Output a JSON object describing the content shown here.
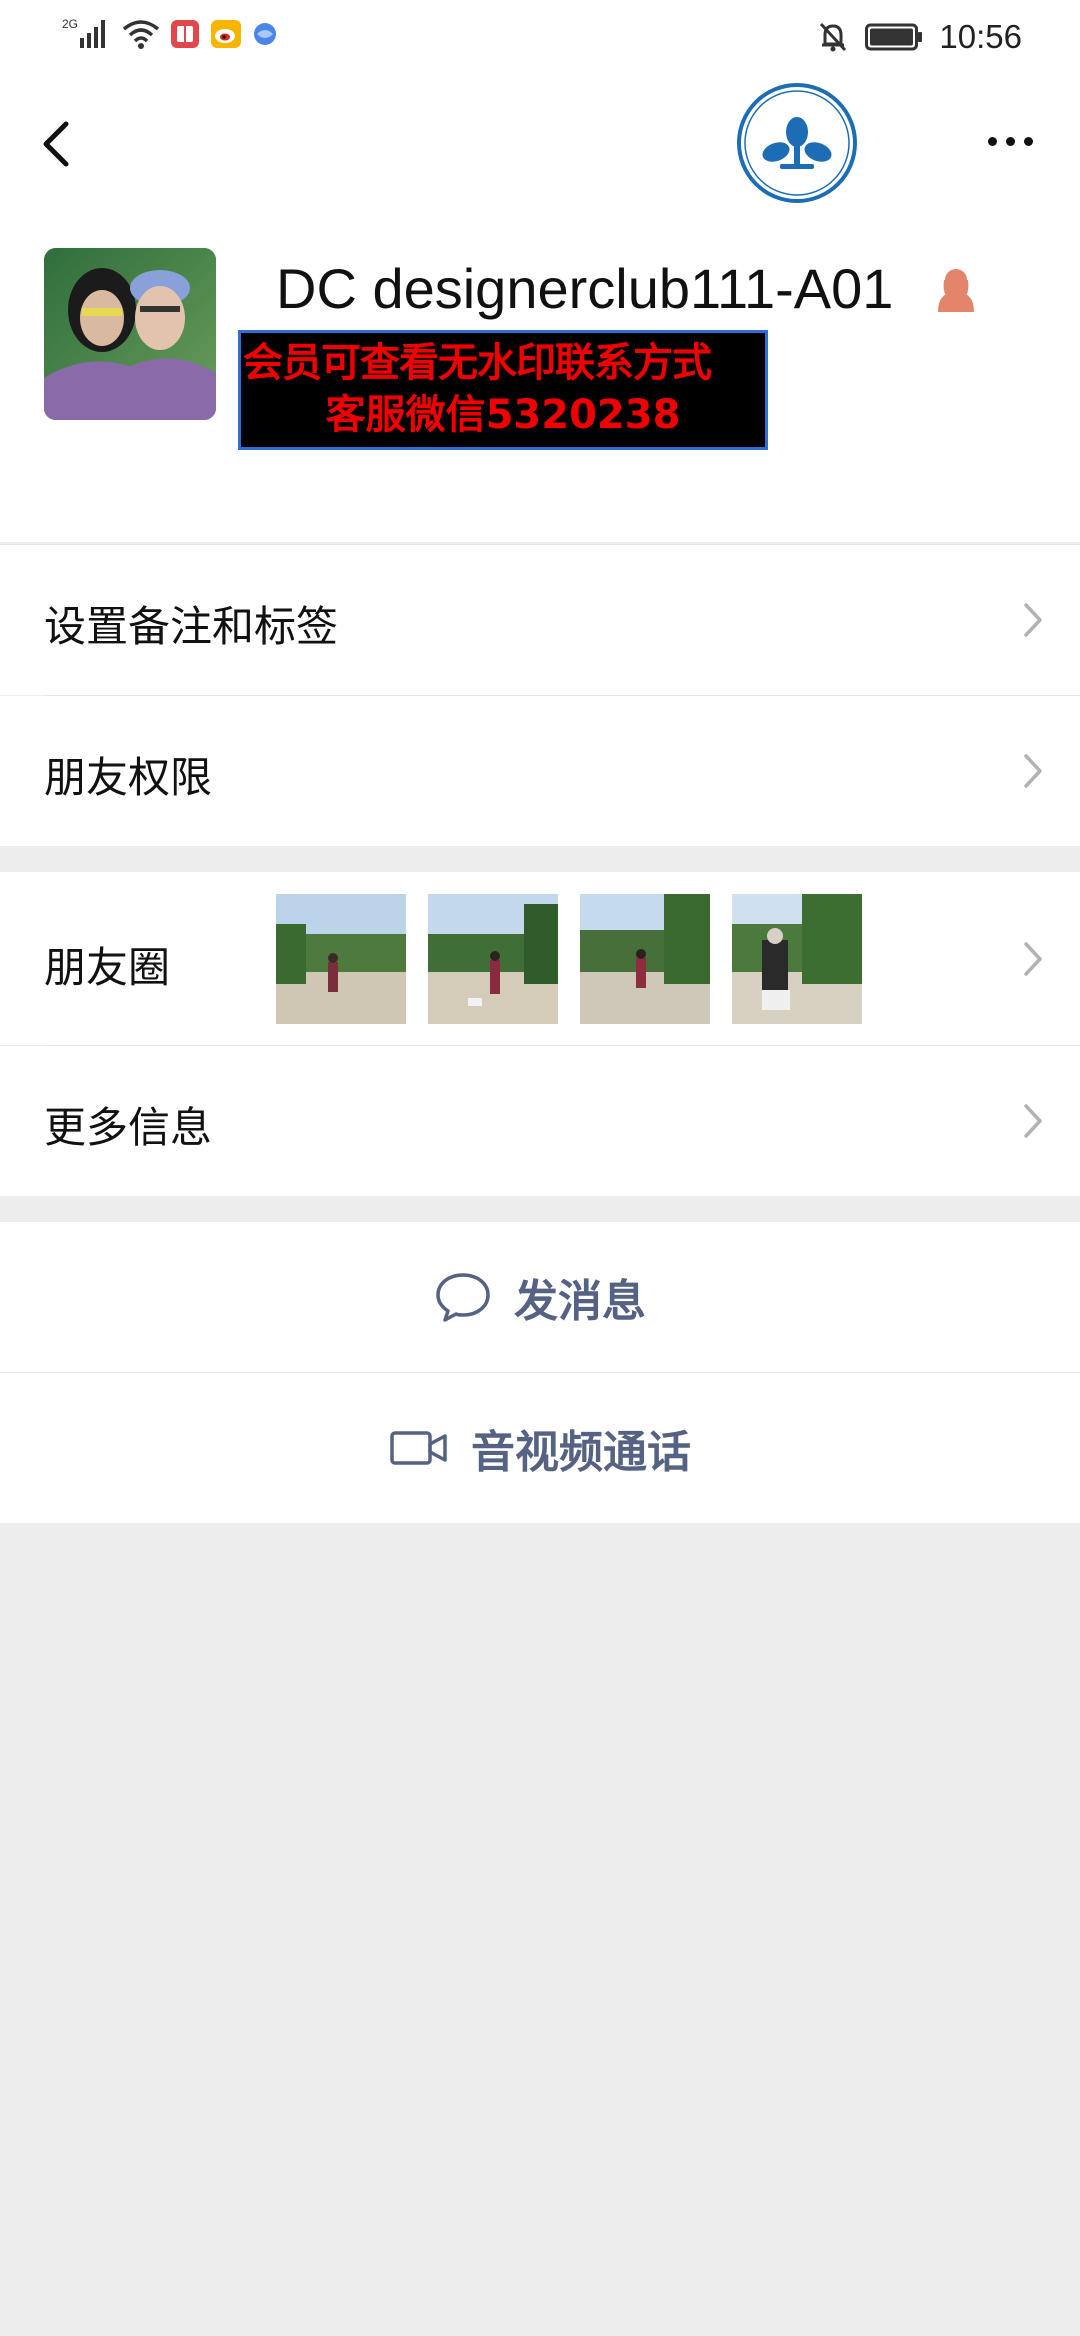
{
  "status_bar": {
    "network": "2G",
    "time": "10:56"
  },
  "profile": {
    "nickname": "DC designerclub111-A01",
    "watermark_line1": "会员可查看无水印联系方式",
    "watermark_line2": "客服微信5320238"
  },
  "menu": {
    "remark_label": "设置备注和标签",
    "permission_label": "朋友权限",
    "moments_label": "朋友圈",
    "more_info_label": "更多信息"
  },
  "actions": {
    "message_label": "发消息",
    "call_label": "音视频通话"
  },
  "colors": {
    "action_text": "#566283",
    "watermark_text": "#f20000",
    "background": "#ededed"
  }
}
